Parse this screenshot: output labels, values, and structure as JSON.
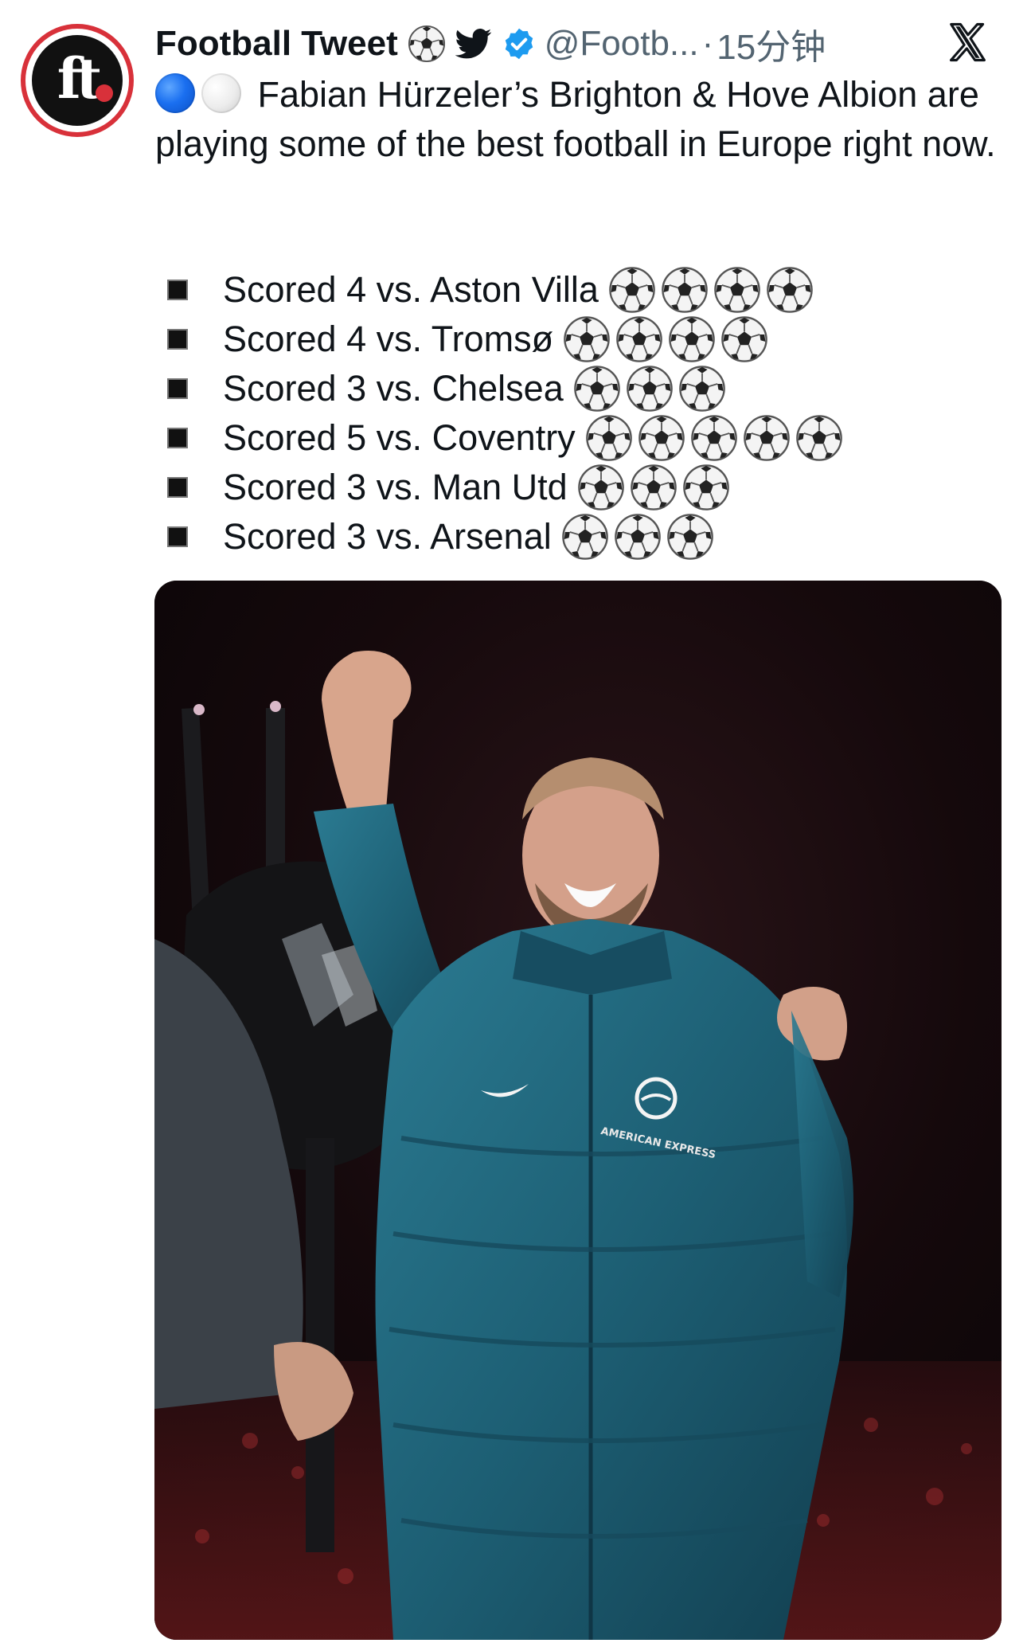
{
  "tweet": {
    "author_name": "Football Tweet",
    "handle": "@Footb...",
    "separator": "·",
    "time": "15分钟",
    "avatar_text": "ft",
    "text_line1": "Fabian Hürzeler’s Brighton & Hove Albion are playing some of the best football in Europe right now.",
    "stats": [
      {
        "text": "Scored 4 vs. Aston Villa",
        "balls": 4
      },
      {
        "text": "Scored 4 vs. Tromsø",
        "balls": 4
      },
      {
        "text": "Scored 3 vs. Chelsea",
        "balls": 3
      },
      {
        "text": "Scored 5 vs. Coventry",
        "balls": 5
      },
      {
        "text": "Scored 3 vs. Man Utd",
        "balls": 3
      },
      {
        "text": "Scored 3 vs. Arsenal",
        "balls": 3
      }
    ],
    "photo_badge_text": "AMERICAN EXPRESS"
  },
  "icons": {
    "header": [
      "soccer-ball-icon",
      "twitter-bird-icon",
      "verified-badge-icon"
    ],
    "close": "x-logo-icon",
    "bullet": "black-square-icon",
    "lead": [
      "blue-circle-icon",
      "white-circle-icon"
    ]
  },
  "colors": {
    "text": "#0f1419",
    "secondary": "#536471",
    "twitter_blue": "#1d9bf0",
    "avatar_ring": "#d8313a",
    "jacket_teal": "#1d5f74"
  }
}
